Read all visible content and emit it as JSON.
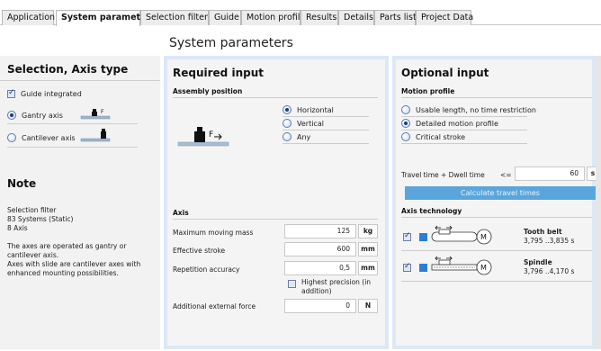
{
  "tabs": [
    {
      "label": "Application",
      "active": false
    },
    {
      "label": "System parameters",
      "active": true
    },
    {
      "label": "Selection filter",
      "active": false
    },
    {
      "label": "Guide",
      "active": false
    },
    {
      "label": "Motion profile",
      "active": false
    },
    {
      "label": "Results",
      "active": false
    },
    {
      "label": "Details",
      "active": false
    },
    {
      "label": "Parts list",
      "active": false
    },
    {
      "label": "Project Data",
      "active": false
    }
  ],
  "page_title": "System parameters",
  "left": {
    "title": "Selection, Axis type",
    "guide_integrated": {
      "label": "Guide integrated",
      "checked": true
    },
    "axis_types": [
      {
        "label": "Gantry axis",
        "selected": true
      },
      {
        "label": "Cantilever axis",
        "selected": false
      }
    ],
    "note_title": "Note",
    "note_lines": [
      "Selection filter",
      "83 Systems (Static)",
      "8 Axis"
    ],
    "note_para1": "The axes are operated as gantry or cantilever axis.",
    "note_para2": "Axes with slide are cantilever axes with enhanced mounting possibilities.",
    "force_symbol": "F"
  },
  "required": {
    "title": "Required input",
    "assembly_label": "Assembly position",
    "assembly_options": [
      {
        "label": "Horizontal",
        "selected": true
      },
      {
        "label": "Vertical",
        "selected": false
      },
      {
        "label": "Any",
        "selected": false
      }
    ],
    "force_symbol": "F",
    "axis_label": "Axis",
    "mass": {
      "label": "Maximum moving mass",
      "value": "125",
      "unit": "kg"
    },
    "stroke": {
      "label": "Effective stroke",
      "value": "600",
      "unit": "mm"
    },
    "accuracy": {
      "label": "Repetition accuracy",
      "value": "0,5",
      "unit": "mm"
    },
    "highest_precision": {
      "label": "Highest precision (in addition)",
      "checked": false
    },
    "force": {
      "label": "Additional external force",
      "value": "0",
      "unit": "N"
    }
  },
  "optional": {
    "title": "Optional input",
    "motion_label": "Motion profile",
    "motion_options": [
      {
        "label": "Usable length, no time restriction",
        "selected": false
      },
      {
        "label": "Detailed motion profile",
        "selected": true
      },
      {
        "label": "Critical stroke",
        "selected": false
      }
    ],
    "travel_label": "Travel time + Dwell time",
    "travel_op": "<=",
    "travel_value": "60",
    "travel_unit": "s",
    "calc_button": "Calculate travel times",
    "tech_label": "Axis technology",
    "techs": [
      {
        "name": "Tooth belt",
        "range": "3,795 ..3,835 s",
        "checked": true,
        "motor": "M"
      },
      {
        "name": "Spindle",
        "range": "3,796 ..4,170 s",
        "checked": true,
        "motor": "M"
      }
    ]
  },
  "colors": {
    "panel_border": "#dce8f5",
    "button": "#5aa6dc",
    "swatch": "#2a7fd4"
  }
}
